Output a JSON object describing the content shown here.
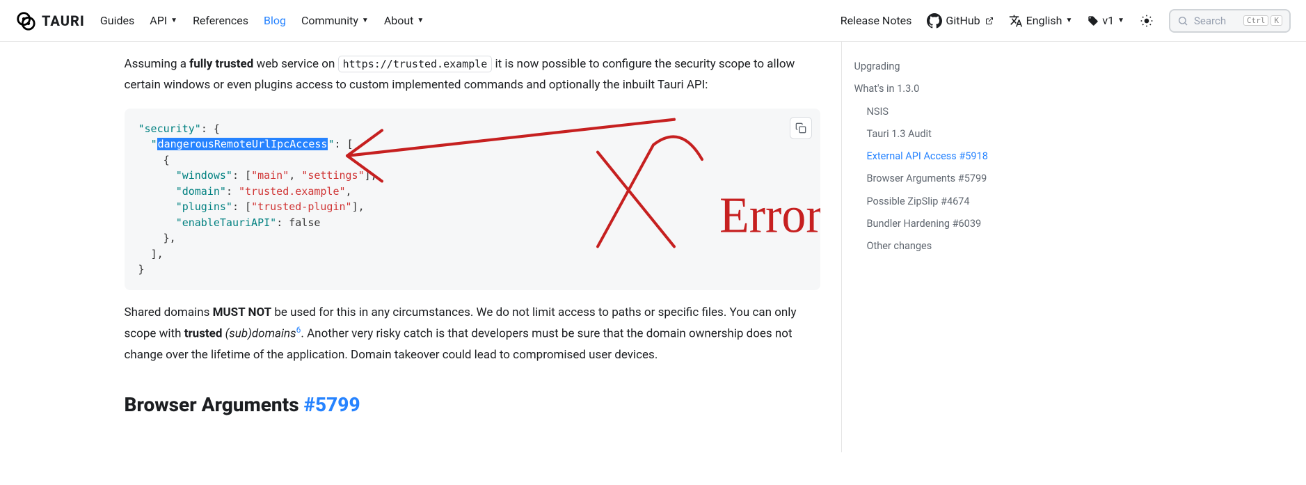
{
  "nav": {
    "brand": "TAURI",
    "items": [
      {
        "label": "Guides",
        "dropdown": false
      },
      {
        "label": "API",
        "dropdown": true
      },
      {
        "label": "References",
        "dropdown": false
      },
      {
        "label": "Blog",
        "dropdown": false,
        "active": true
      },
      {
        "label": "Community",
        "dropdown": true
      },
      {
        "label": "About",
        "dropdown": true
      }
    ],
    "release_notes": "Release Notes",
    "github": "GitHub",
    "language": "English",
    "version": "v1",
    "search_placeholder": "Search",
    "search_kbd1": "Ctrl",
    "search_kbd2": "K"
  },
  "article": {
    "p1_pre": "Assuming a ",
    "p1_strong": "fully trusted",
    "p1_mid": " web service on ",
    "p1_code": "https://trusted.example",
    "p1_post": " it is now possible to configure the security scope to allow certain windows or even plugins access to custom implemented commands and optionally the inbuilt Tauri API:",
    "code": {
      "security_key": "\"security\"",
      "dangerous_key": "dangerousRemoteUrlIpcAccess",
      "windows_key": "\"windows\"",
      "windows_v1": "\"main\"",
      "windows_v2": "\"settings\"",
      "domain_key": "\"domain\"",
      "domain_val": "\"trusted.example\"",
      "plugins_key": "\"plugins\"",
      "plugins_val": "\"trusted-plugin\"",
      "enable_key": "\"enableTauriAPI\"",
      "enable_val": "false"
    },
    "annotation_text": "Error",
    "p2_pre": "Shared domains ",
    "p2_strong": "MUST NOT",
    "p2_mid": " be used for this in any circumstances. We do not limit access to paths or specific files. You can only scope with ",
    "p2_strong2": "trusted",
    "p2_em": " (sub)domains",
    "p2_sup": "6",
    "p2_post": ". Another very risky catch is that developers must be sure that the domain ownership does not change over the lifetime of the application. Domain takeover could lead to compromised user devices.",
    "h2_text": "Browser Arguments ",
    "h2_link": "#5799"
  },
  "toc": {
    "items": [
      {
        "label": "Upgrading",
        "level": 1
      },
      {
        "label": "What's in 1.3.0",
        "level": 1
      },
      {
        "label": "NSIS",
        "level": 2
      },
      {
        "label": "Tauri 1.3 Audit",
        "level": 2
      },
      {
        "label": "External API Access #5918",
        "level": 2,
        "active": true
      },
      {
        "label": "Browser Arguments #5799",
        "level": 2
      },
      {
        "label": "Possible ZipSlip #4674",
        "level": 2
      },
      {
        "label": "Bundler Hardening #6039",
        "level": 2
      },
      {
        "label": "Other changes",
        "level": 2
      }
    ]
  }
}
